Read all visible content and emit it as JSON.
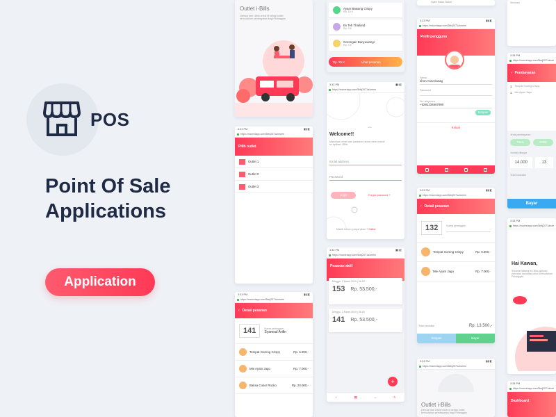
{
  "promo": {
    "brand": "POS",
    "headline": "Point Of Sale Applications",
    "tag": "Application"
  },
  "common": {
    "time": "3:33 PM",
    "url": "https://marvelapp.com/5bbj2071a/sreen"
  },
  "outlet_screen": {
    "title": "Outlet i-Bills",
    "subtitle": "Dimulai dari i-Bills untuk di setiap outlet, kemudahan pembayaran bagi Pelanggan",
    "signal": "▮▮▮"
  },
  "pilih_outlet": {
    "title": "Pilih outlet",
    "items": [
      "Outlet 1",
      "Outlet 2",
      "Outlet 3"
    ]
  },
  "detail_left": {
    "title": "Detail pesanan",
    "order_no": "141",
    "customer_label": "Nama pelanggan",
    "customer": "Syamsul Arifin",
    "items": [
      {
        "name": "Tempat Goreng Crispy",
        "price": "Rp. 6.900,-",
        "status": "Selesai"
      },
      {
        "name": "Mie Ayam Jago",
        "price": "Rp. 7.000,-",
        "status": "Selesai"
      },
      {
        "name": "Bakso Cokor Rocko",
        "price": "Rp. 20.000,-",
        "status": "Selesai"
      }
    ]
  },
  "menu_list": {
    "items": [
      {
        "name": "Ayam Bawang Crispy",
        "price": "Rp. 10 K",
        "color": "#56d68c"
      },
      {
        "name": "Es Teh Thailand",
        "price": "Rp. 5 K",
        "color": "#c9a8e8"
      },
      {
        "name": "Gorengan Banyuwangi",
        "price": "Rp. 3 K",
        "color": "#f7d46b"
      },
      {
        "name": "Bakso Goreng",
        "price": "Rp. 5 K",
        "color": "#f5b07a"
      }
    ],
    "cart_total": "Rp. 25 K",
    "cart_label": "Lihat pesanan",
    "last": "Ayam Bakar Bakar"
  },
  "login": {
    "title": "Welcome!!",
    "text": "Masukkan email dan password anda untuk masuk ke aplikasi i-Bills",
    "email": "Email address",
    "password": "Password",
    "login": "Login",
    "forgot": "Forgot password ?",
    "register": "Masih belum punya akun ?",
    "register_link": "Daftar"
  },
  "pesanan_aktif": {
    "title": "Pesanan aktif",
    "cards": [
      {
        "no": "153",
        "price": "Rp. 53.500,-",
        "meta": "Minggu, 2 Maret 2019 | 06.00"
      },
      {
        "no": "141",
        "price": "Rp. 53.500,-",
        "meta": "Minggu, 2 Maret 2019 | 06.00"
      }
    ],
    "fab": "+"
  },
  "profil": {
    "title": "Profil pengguna",
    "name_label": "Nama",
    "name": "Jhon Annerianag",
    "pass_label": "Password",
    "phone_label": "No. telephone",
    "phone": "+6281234567890",
    "save": "Simpan",
    "logout": "Keluar",
    "top": "Ayam Bakar Bakar"
  },
  "detail_right": {
    "title": "Detail pesanan",
    "order_no": "132",
    "customer_label": "Nama pelanggan",
    "items": [
      {
        "name": "Tempat Goreng Crispy",
        "price": "Rp. 6.900,-"
      },
      {
        "name": "Mie Ayam Jago",
        "price": "Rp. 7.000,-"
      }
    ],
    "total_label": "Total transaksi",
    "total": "Rp. 13.500,-",
    "save": "Simpan",
    "pay": "Bayar"
  },
  "outlet_bottom": {
    "title": "Outlet i-Bills",
    "subtitle": "Dimulai dari i-Bills untuk di setiap outlet, kemudahan pembayaran bagi Pelanggan"
  },
  "pembayaran": {
    "title": "Pembayaran",
    "top": "Pembelian",
    "items": [
      {
        "qty": "1",
        "name": "Tempat Goreng Crispy"
      },
      {
        "qty": "1",
        "name": "Mie Ayam Jago"
      }
    ],
    "method_label": "Jenis pembayaran",
    "methods": [
      "Tunai",
      "Debit"
    ],
    "amount_label": "Jumlah dibayar",
    "amounts": [
      "14.000",
      "13"
    ],
    "total_label": "Total transaksi",
    "pay": "Bayar"
  },
  "hai": {
    "title": "Hai Kawan,",
    "text": "Selamat datang di i-Bills aplikasi pencatat transaksi untuk kemudahan Pelanggan"
  },
  "dashboard": {
    "title": "Dashboard"
  }
}
